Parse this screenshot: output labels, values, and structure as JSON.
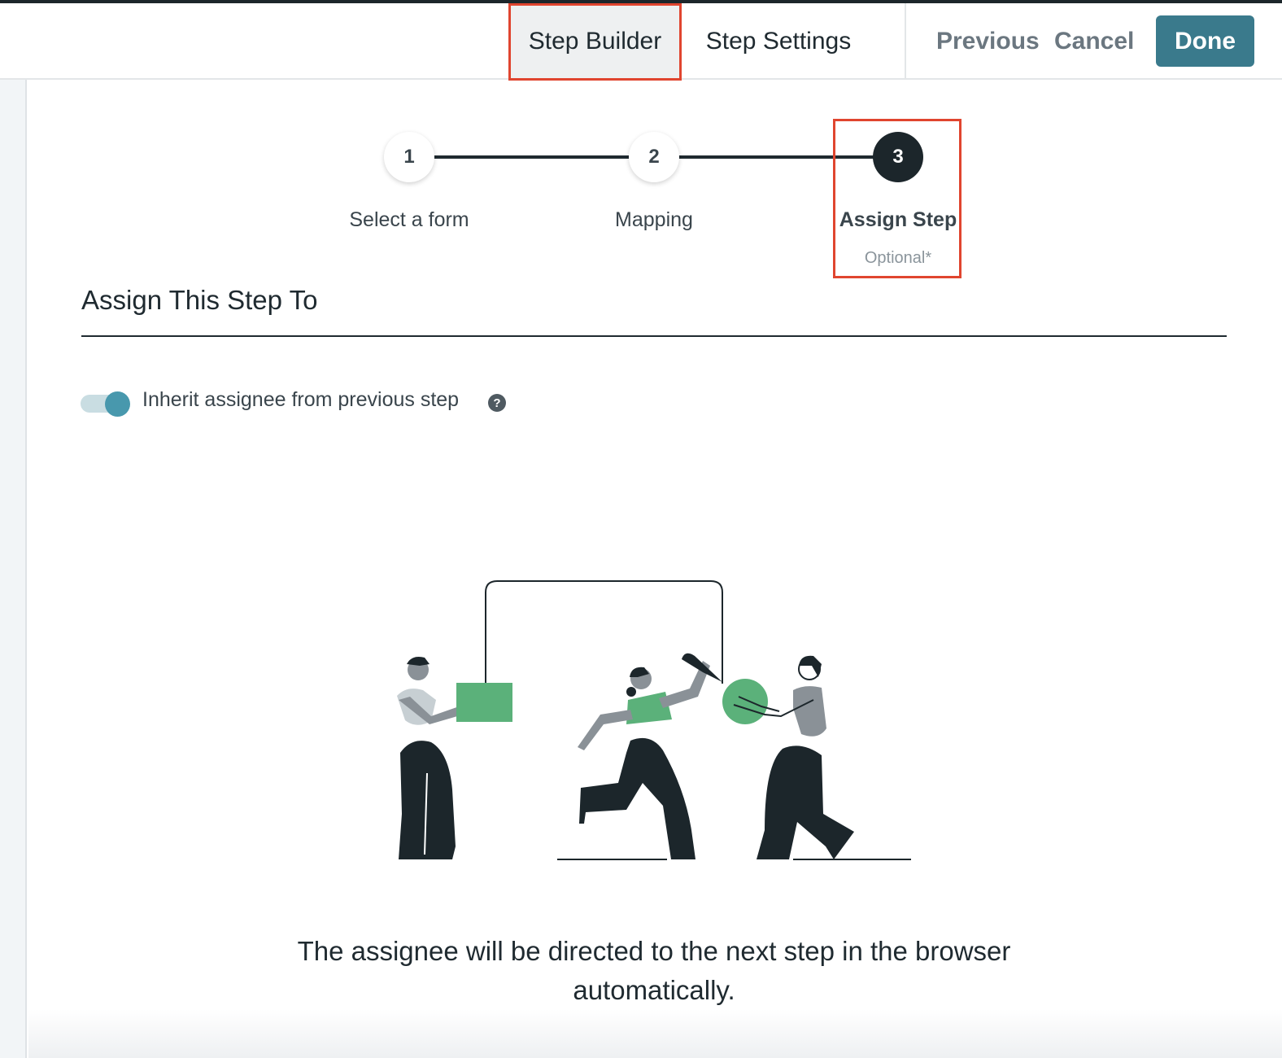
{
  "topbar": {
    "tabs": [
      {
        "label": "Step Builder",
        "selected": true
      },
      {
        "label": "Step Settings",
        "selected": false
      }
    ],
    "previous_label": "Previous",
    "cancel_label": "Cancel",
    "done_label": "Done"
  },
  "stepper": {
    "steps": [
      {
        "number": "1",
        "label": "Select a form",
        "sublabel": ""
      },
      {
        "number": "2",
        "label": "Mapping",
        "sublabel": ""
      },
      {
        "number": "3",
        "label": "Assign Step",
        "sublabel": "Optional*",
        "active": true
      }
    ]
  },
  "section": {
    "title": "Assign This Step To",
    "toggle_label": "Inherit assignee from previous step",
    "toggle_on": true,
    "help_icon_glyph": "?"
  },
  "description": "The assignee will be directed to the next step in the browser automatically.",
  "colors": {
    "accent": "#3a7a8c",
    "toggle": "#4898ad",
    "highlight": "#e0452f",
    "illustration_green": "#5bb17a",
    "illustration_dark": "#1c262b",
    "illustration_gray": "#8a9197"
  }
}
